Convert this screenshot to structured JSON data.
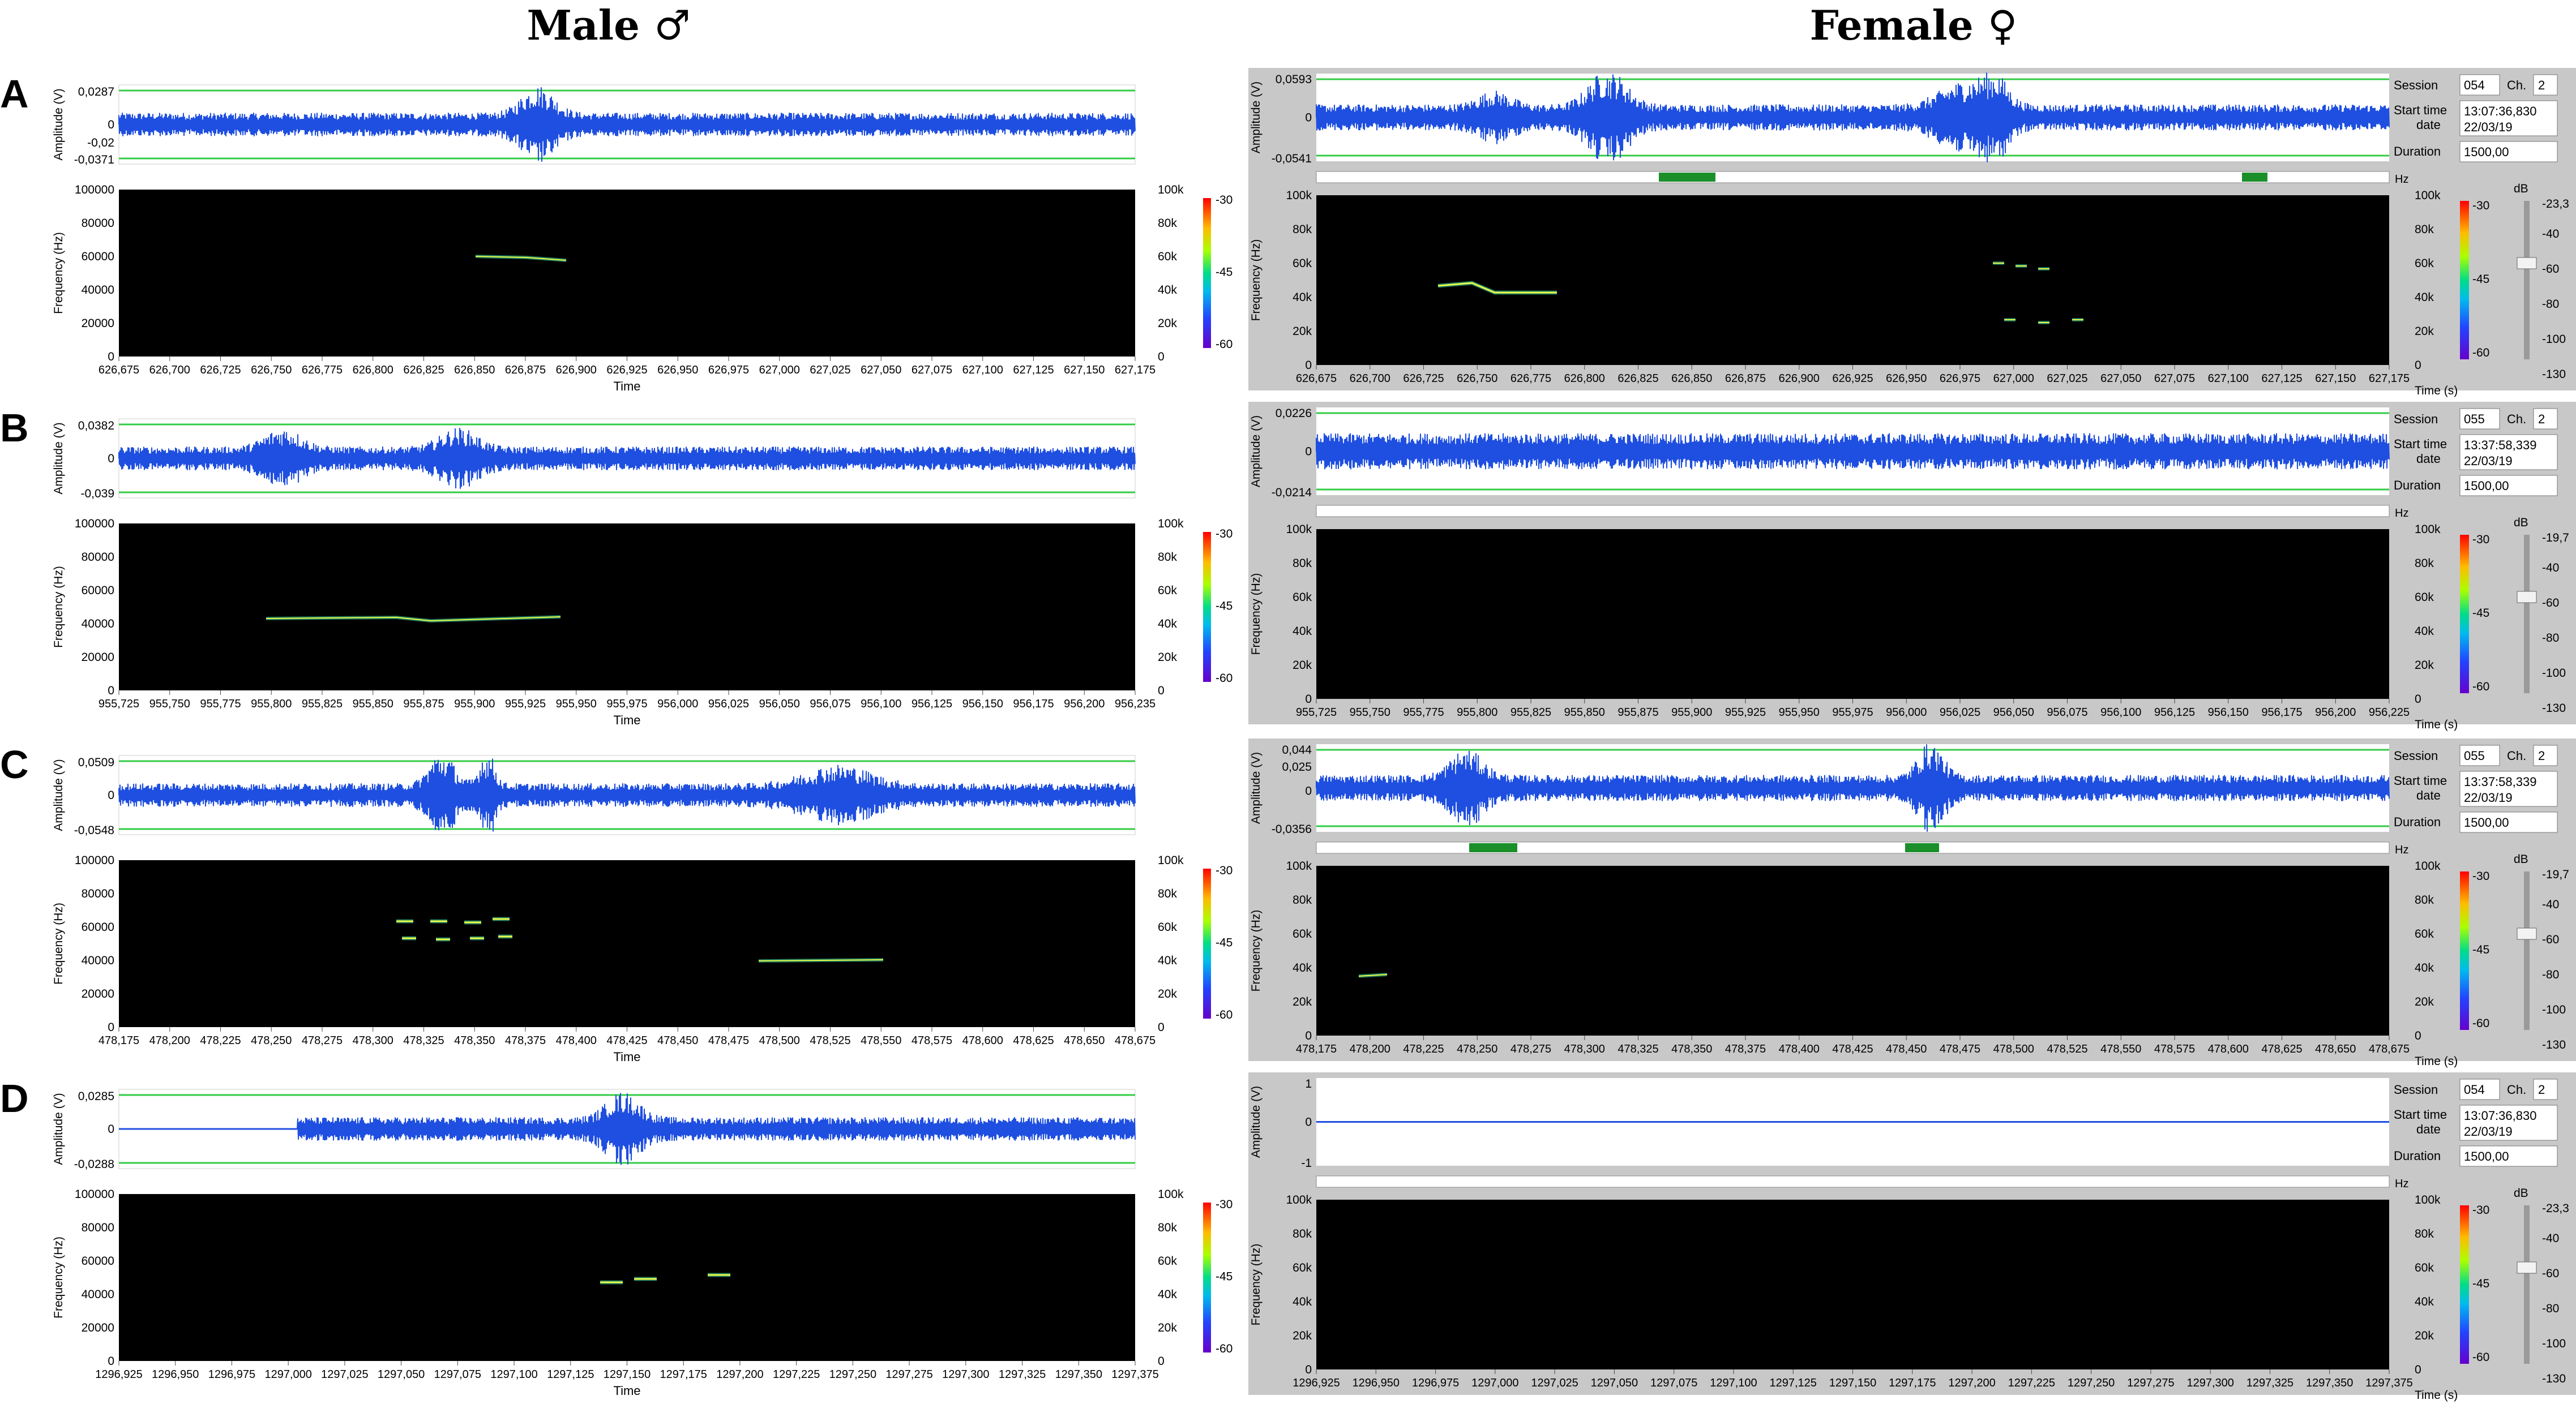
{
  "header": {
    "male": "Male ♂",
    "female": "Female ♀"
  },
  "labels": {
    "amplitude": "Amplitude (V)",
    "frequency_hz": "Frequency (Hz)",
    "time": "Time",
    "time_s": "Time (s)",
    "hz": "Hz",
    "db": "dB",
    "session": "Session",
    "ch": "Ch.",
    "start_time": "Start time",
    "date": "date",
    "duration": "Duration"
  },
  "freq_ticks_hz": [
    "100000",
    "80000",
    "60000",
    "40000",
    "20000",
    "0"
  ],
  "freq_ticks_k": [
    "100k",
    "80k",
    "60k",
    "40k",
    "20k",
    "0"
  ],
  "colorbar_ticks": [
    "-30",
    "-45",
    "-60"
  ],
  "slider_ticks": [
    "-40",
    "-60",
    "-80",
    "-100",
    "-130"
  ],
  "colors": {
    "wave": "#1f4fe0",
    "green": "#33cc44",
    "spec_bg": "#000000",
    "panel_gray": "#c8c8c8"
  },
  "rows": [
    {
      "letter": "A",
      "male": {
        "amp_ticks": [
          "0,0287",
          "0",
          "-0,02",
          "-0,0371"
        ],
        "time_ticks": [
          "626,675",
          "626,700",
          "626,725",
          "626,750",
          "626,775",
          "626,800",
          "626,825",
          "626,850",
          "626,875",
          "626,900",
          "626,925",
          "626,950",
          "626,975",
          "627,000",
          "627,025",
          "627,050",
          "627,075",
          "627,100",
          "627,125",
          "627,150",
          "627,175"
        ]
      },
      "female": {
        "amp_ticks": [
          "0,0593",
          "0",
          "-0,0541"
        ],
        "time_ticks": [
          "626,675",
          "626,700",
          "626,725",
          "626,750",
          "626,775",
          "626,800",
          "626,825",
          "626,850",
          "626,875",
          "626,900",
          "626,925",
          "626,950",
          "626,975",
          "627,000",
          "627,025",
          "627,050",
          "627,075",
          "627,100",
          "627,125",
          "627,150",
          "627,175"
        ],
        "session": "054",
        "ch": "2",
        "start_time": "13:07:36,830",
        "date": "22/03/19",
        "duration": "1500,00",
        "db_top": "-23,3"
      }
    },
    {
      "letter": "B",
      "male": {
        "amp_ticks": [
          "0,0382",
          "0",
          "-0,039"
        ],
        "time_ticks": [
          "955,725",
          "955,750",
          "955,775",
          "955,800",
          "955,825",
          "955,850",
          "955,875",
          "955,900",
          "955,925",
          "955,950",
          "955,975",
          "956,000",
          "956,025",
          "956,050",
          "956,075",
          "956,100",
          "956,125",
          "956,150",
          "956,175",
          "956,200",
          "956,235"
        ]
      },
      "female": {
        "amp_ticks": [
          "0,0226",
          "0",
          "-0,0214"
        ],
        "time_ticks": [
          "955,725",
          "955,750",
          "955,775",
          "955,800",
          "955,825",
          "955,850",
          "955,875",
          "955,900",
          "955,925",
          "955,950",
          "955,975",
          "956,000",
          "956,025",
          "956,050",
          "956,075",
          "956,100",
          "956,125",
          "956,150",
          "956,175",
          "956,200",
          "956,225"
        ],
        "session": "055",
        "ch": "2",
        "start_time": "13:37:58,339",
        "date": "22/03/19",
        "duration": "1500,00",
        "db_top": "-19,7"
      }
    },
    {
      "letter": "C",
      "male": {
        "amp_ticks": [
          "0,0509",
          "0",
          "-0,0548"
        ],
        "time_ticks": [
          "478,175",
          "478,200",
          "478,225",
          "478,250",
          "478,275",
          "478,300",
          "478,325",
          "478,350",
          "478,375",
          "478,400",
          "478,425",
          "478,450",
          "478,475",
          "478,500",
          "478,525",
          "478,550",
          "478,575",
          "478,600",
          "478,625",
          "478,650",
          "478,675"
        ]
      },
      "female": {
        "amp_ticks": [
          "0,044",
          "0,025",
          "0",
          "-0,0356"
        ],
        "time_ticks": [
          "478,175",
          "478,200",
          "478,225",
          "478,250",
          "478,275",
          "478,300",
          "478,325",
          "478,350",
          "478,375",
          "478,400",
          "478,425",
          "478,450",
          "478,475",
          "478,500",
          "478,525",
          "478,550",
          "478,575",
          "478,600",
          "478,625",
          "478,650",
          "478,675"
        ],
        "session": "055",
        "ch": "2",
        "start_time": "13:37:58,339",
        "date": "22/03/19",
        "duration": "1500,00",
        "db_top": "-19,7"
      }
    },
    {
      "letter": "D",
      "male": {
        "amp_ticks": [
          "0,0285",
          "0",
          "-0,0288"
        ],
        "time_ticks": [
          "1296,925",
          "1296,950",
          "1296,975",
          "1297,000",
          "1297,025",
          "1297,050",
          "1297,075",
          "1297,100",
          "1297,125",
          "1297,150",
          "1297,175",
          "1297,200",
          "1297,225",
          "1297,250",
          "1297,275",
          "1297,300",
          "1297,325",
          "1297,350",
          "1297,375"
        ]
      },
      "female": {
        "amp_ticks": [
          "1",
          "0",
          "-1"
        ],
        "time_ticks": [
          "1296,925",
          "1296,950",
          "1296,975",
          "1297,000",
          "1297,025",
          "1297,050",
          "1297,075",
          "1297,100",
          "1297,125",
          "1297,150",
          "1297,175",
          "1297,200",
          "1297,225",
          "1297,250",
          "1297,275",
          "1297,300",
          "1297,325",
          "1297,350",
          "1297,375"
        ],
        "session": "054",
        "ch": "2",
        "start_time": "13:07:36,830",
        "date": "22/03/19",
        "duration": "1500,00",
        "db_top": "-23,3"
      }
    }
  ]
}
